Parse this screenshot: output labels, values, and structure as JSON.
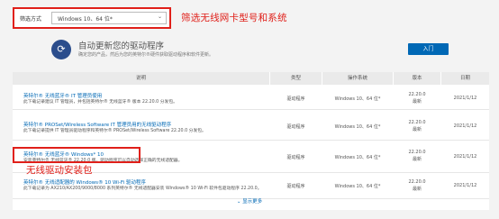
{
  "filter": {
    "label": "筛选方式",
    "selected": "Windows 10、64 位*",
    "chevron_icon": "chevron-down-icon"
  },
  "annotations": {
    "top": "筛选无线网卡型号和系统",
    "bottom": "无线驱动安装包",
    "color": "#e0201a"
  },
  "banner": {
    "title": "自动更新您的驱动程序",
    "description": "确定您的产品，然后为您的英特尔®硬件获取驱动程序和软件更新。",
    "button_label": "入门",
    "icon": "refresh-icon",
    "accent": "#0068b5"
  },
  "table": {
    "headers": [
      "说明",
      "类型",
      "操作系统",
      "版本",
      "日期"
    ],
    "rows": [
      {
        "title": "英特尔® 无线蓝牙® IT 管理员使用",
        "description": "此下载记录建议 IT 管理员，并包括英特尔® 无线蓝牙® 版本 22.20.0 分发包。",
        "type": "驱动程序",
        "os": "Windows 10、64 位*",
        "version": "22.20.0",
        "version_note": "最新",
        "date": "2021/1/12"
      },
      {
        "title": "英特尔® PROSet/Wireless Software IT 管理员用的无线驱动程序",
        "description": "此下载记录提供 IT 管理员驱动程序和英特尔® PROSet/Wireless Software 22.20.0 分发包。",
        "type": "驱动程序",
        "os": "Windows 10、64 位*",
        "version": "22.20.0",
        "version_note": "最新",
        "date": "2021/1/12"
      },
      {
        "title": "英特尔® 无线蓝牙® Windows* 10",
        "description": "安装英特尔® 无线蓝牙® 22.20.0 版。驱动程序可以自动选择正确的无线适配器。",
        "type": "驱动程序",
        "os": "Windows 10、64 位*",
        "version": "22.20.0",
        "version_note": "最新",
        "date": "2021/1/12"
      },
      {
        "title": "英特尔® 无线适配器的 Windows® 10 Wi-Fi 驱动程序",
        "description": "此下载记录为 AX210/AX200/9000/8000 系列英特尔® 无线适配器安装 Windows® 10 Wi-Fi 软件包驱动程序 22.20.0。",
        "type": "驱动程序",
        "os": "Windows 10、64 位*",
        "version": "22.20.0",
        "version_note": "最新",
        "date": "2021/1/12"
      }
    ]
  },
  "show_more": "⌄ 显示更多"
}
